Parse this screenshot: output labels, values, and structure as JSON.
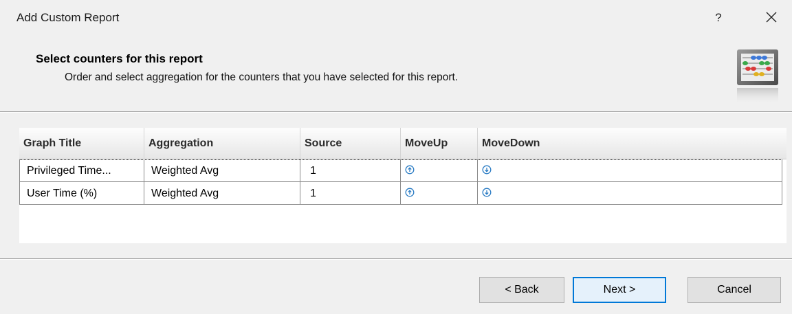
{
  "window": {
    "title": "Add Custom Report",
    "help_label": "?"
  },
  "header": {
    "title": "Select counters for this report",
    "subtitle": "Order and select aggregation for the counters that you have selected for this report.",
    "icon": "abacus-icon"
  },
  "grid": {
    "columns": [
      "Graph Title",
      "Aggregation",
      "Source",
      "MoveUp",
      "MoveDown"
    ],
    "rows": [
      {
        "graph_title": "Privileged Time...",
        "aggregation": "Weighted Avg",
        "source": "1",
        "move_up": "arrow-up-circle-icon",
        "move_down": "arrow-down-circle-icon"
      },
      {
        "graph_title": "User Time (%)",
        "aggregation": "Weighted Avg",
        "source": "1",
        "move_up": "arrow-up-circle-icon",
        "move_down": "arrow-down-circle-icon"
      }
    ]
  },
  "footer": {
    "back_label": "< Back",
    "next_label": "Next >",
    "cancel_label": "Cancel"
  },
  "colors": {
    "accent": "#0078d7",
    "arrow_icon": "#2b7cc4"
  }
}
